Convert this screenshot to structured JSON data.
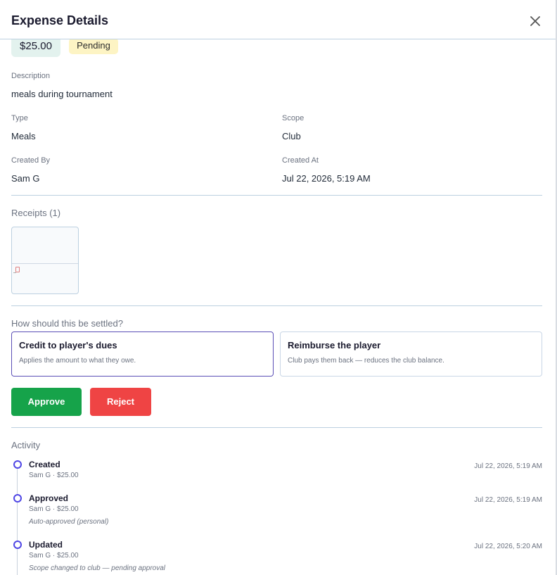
{
  "header": {
    "title": "Expense Details"
  },
  "expense": {
    "amount": "$25.00",
    "status": "Pending",
    "description_label": "Description",
    "description": "meals during tournament",
    "type_label": "Type",
    "type": "Meals",
    "scope_label": "Scope",
    "scope": "Club",
    "created_by_label": "Created By",
    "created_by": "Sam G",
    "created_at_label": "Created At",
    "created_at": "Jul 22, 2026, 5:19 AM"
  },
  "receipts": {
    "title": "Receipts (1)"
  },
  "settlement": {
    "question": "How should this be settled?",
    "options": [
      {
        "title": "Credit to player's dues",
        "desc": "Applies the amount to what they owe.",
        "selected": true
      },
      {
        "title": "Reimburse the player",
        "desc": "Club pays them back — reduces the club balance.",
        "selected": false
      }
    ]
  },
  "actions": {
    "approve_label": "Approve",
    "reject_label": "Reject"
  },
  "activity": {
    "title": "Activity",
    "events": [
      {
        "title": "Created",
        "meta": "Sam G  · $25.00",
        "note": "",
        "time": "Jul 22, 2026, 5:19 AM"
      },
      {
        "title": "Approved",
        "meta": "Sam G  · $25.00",
        "note": "Auto-approved (personal)",
        "time": "Jul 22, 2026, 5:19 AM"
      },
      {
        "title": "Updated",
        "meta": "Sam G  · $25.00",
        "note": "Scope changed to club — pending approval",
        "time": "Jul 22, 2026, 5:20 AM"
      }
    ]
  },
  "colors": {
    "approve": "#16a34a",
    "reject": "#ef4444",
    "accent": "#4f46e5",
    "pending_bg": "#fdf4c4",
    "amount_bg": "#e3f2ee"
  },
  "icons": {
    "close": "close-icon",
    "receipt": "receipt-thumbnail"
  }
}
